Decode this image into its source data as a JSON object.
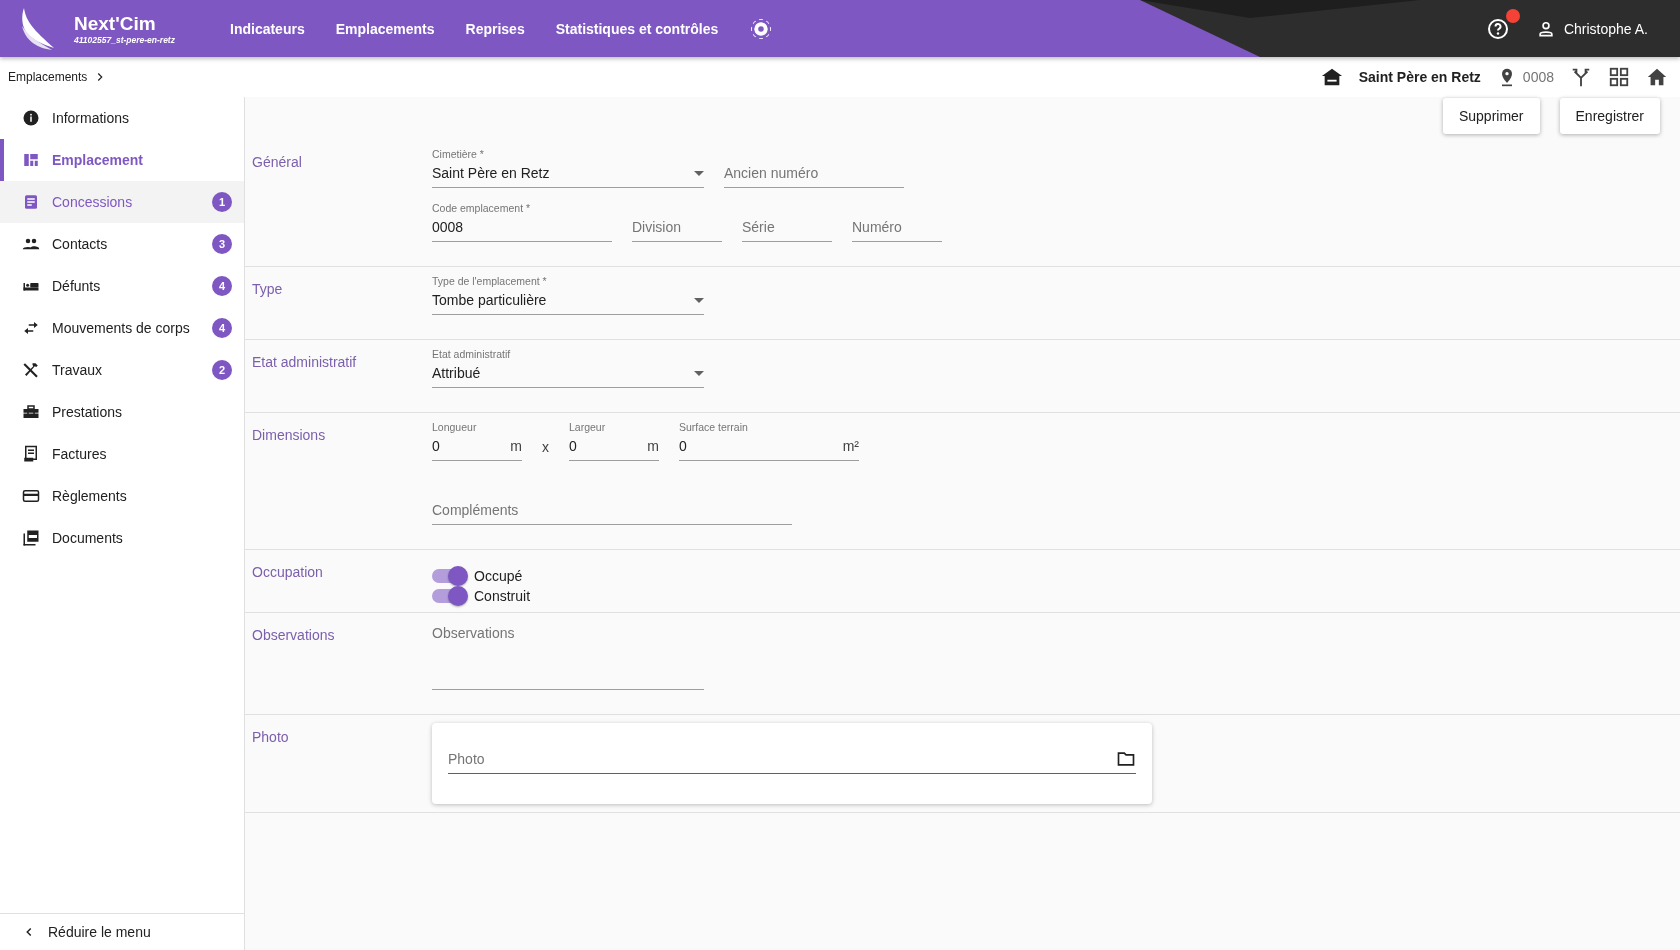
{
  "header": {
    "app_name": "Next'Cim",
    "instance": "41102557_st-pere-en-retz",
    "nav": [
      "Indicateurs",
      "Emplacements",
      "Reprises",
      "Statistiques et contrôles"
    ],
    "help_notification": true,
    "user": "Christophe A."
  },
  "breadcrumb": {
    "items": [
      "Emplacements"
    ],
    "cemetery": "Saint Père en Retz",
    "location_code": "0008"
  },
  "sidebar": {
    "items": [
      {
        "label": "Informations",
        "selected": false,
        "hovered": false
      },
      {
        "label": "Emplacement",
        "selected": true,
        "hovered": false
      },
      {
        "label": "Concessions",
        "selected": false,
        "hovered": true,
        "badge": "1"
      },
      {
        "label": "Contacts",
        "selected": false,
        "hovered": false,
        "badge": "3"
      },
      {
        "label": "Défunts",
        "selected": false,
        "hovered": false,
        "badge": "4"
      },
      {
        "label": "Mouvements de corps",
        "selected": false,
        "hovered": false,
        "badge": "4"
      },
      {
        "label": "Travaux",
        "selected": false,
        "hovered": false,
        "badge": "2"
      },
      {
        "label": "Prestations",
        "selected": false,
        "hovered": false
      },
      {
        "label": "Factures",
        "selected": false,
        "hovered": false
      },
      {
        "label": "Règlements",
        "selected": false,
        "hovered": false
      },
      {
        "label": "Documents",
        "selected": false,
        "hovered": false
      }
    ],
    "collapse": "Réduire le menu"
  },
  "actions": [
    "Supprimer",
    "Enregistrer"
  ],
  "sections": [
    {
      "title": "Général",
      "lines": [
        {
          "fields": [
            {
              "kind": "select",
              "label": "Cimetière *",
              "value": "Saint Père en Retz"
            },
            {
              "kind": "text",
              "placeholder": "Ancien numéro"
            }
          ]
        },
        {
          "fields": [
            {
              "kind": "text",
              "label": "Code emplacement *",
              "value": "0008"
            },
            {
              "kind": "text",
              "placeholder": "Division"
            },
            {
              "kind": "text",
              "placeholder": "Série"
            },
            {
              "kind": "text",
              "placeholder": "Numéro"
            }
          ]
        }
      ]
    },
    {
      "title": "Type",
      "lines": [
        {
          "fields": [
            {
              "kind": "select",
              "label": "Type de l'emplacement *",
              "value": "Tombe particulière"
            }
          ]
        }
      ]
    },
    {
      "title": "Etat administratif",
      "lines": [
        {
          "fields": [
            {
              "kind": "select",
              "label": "Etat administratif",
              "value": "Attribué"
            }
          ]
        }
      ]
    },
    {
      "title": "Dimensions",
      "lines": [
        {
          "fields": [
            {
              "kind": "unit",
              "label": "Longueur",
              "value": "0",
              "unit": "m"
            },
            {
              "kind": "sep",
              "text": "x"
            },
            {
              "kind": "unit",
              "label": "Largeur",
              "value": "0",
              "unit": "m"
            },
            {
              "kind": "unit",
              "label": "Surface terrain",
              "value": "0",
              "unit": "m²"
            }
          ]
        },
        {
          "fields": [
            {
              "kind": "text",
              "placeholder": "Compléments"
            }
          ]
        }
      ]
    },
    {
      "title": "Occupation",
      "lines": [
        {
          "fields": [
            {
              "kind": "switch",
              "label": "Occupé",
              "on": true
            }
          ]
        },
        {
          "fields": [
            {
              "kind": "switch",
              "label": "Construit",
              "on": true
            }
          ]
        }
      ]
    },
    {
      "title": "Observations",
      "lines": [
        {
          "fields": [
            {
              "kind": "textarea",
              "placeholder": "Observations"
            }
          ]
        }
      ]
    },
    {
      "title": "Photo",
      "lines": [
        {
          "fields": [
            {
              "kind": "file",
              "placeholder": "Photo"
            }
          ]
        }
      ]
    }
  ]
}
